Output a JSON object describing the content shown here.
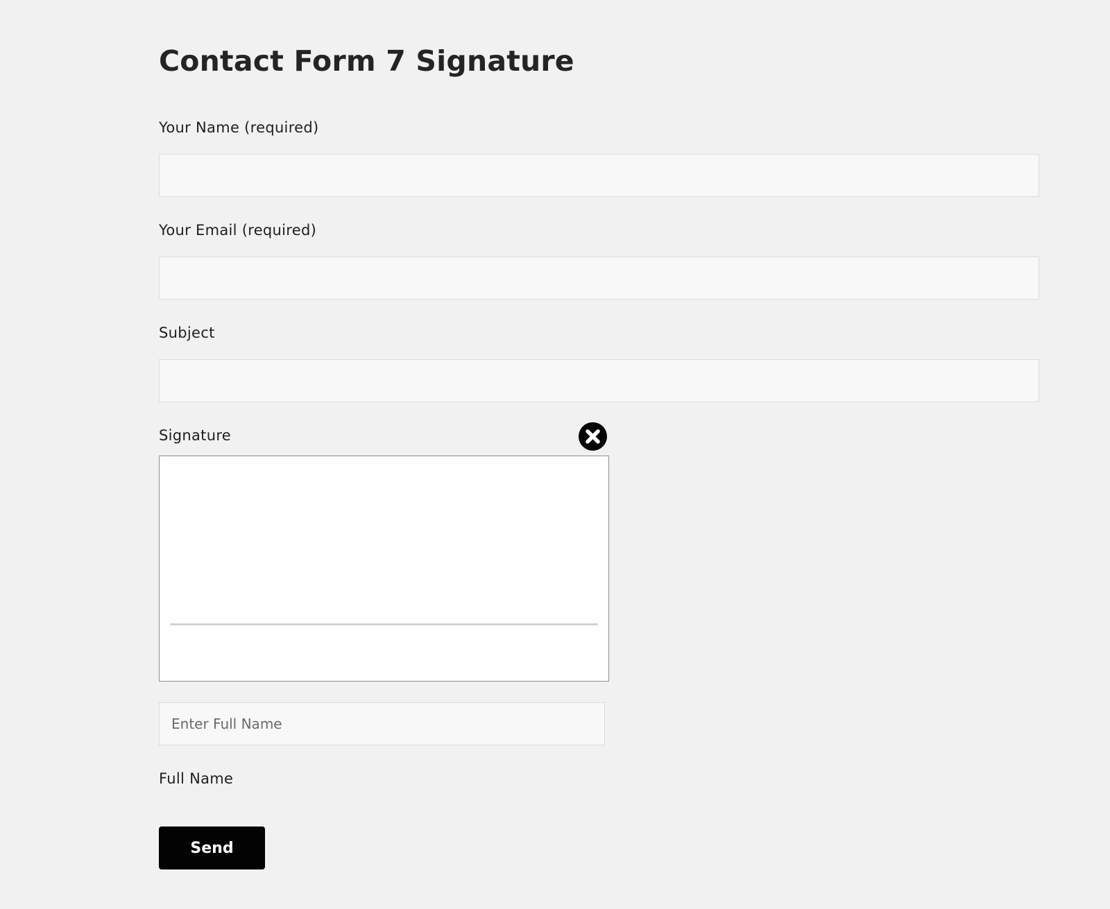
{
  "page": {
    "title": "Contact Form 7 Signature"
  },
  "form": {
    "name": {
      "label": "Your Name (required)",
      "value": "",
      "placeholder": ""
    },
    "email": {
      "label": "Your Email (required)",
      "value": "",
      "placeholder": ""
    },
    "subject": {
      "label": "Subject",
      "value": "",
      "placeholder": ""
    },
    "signature": {
      "label": "Signature",
      "clear_icon": "close-circle-icon"
    },
    "full_name": {
      "value": "",
      "placeholder": "Enter Full Name",
      "label": "Full Name"
    },
    "submit": {
      "label": "Send"
    }
  },
  "colors": {
    "background": "#f1f1f1",
    "input_background": "#f8f8f8",
    "input_border": "#dddddd",
    "button_background": "#030303",
    "button_text": "#ffffff",
    "signature_line": "#d2d2d2"
  }
}
